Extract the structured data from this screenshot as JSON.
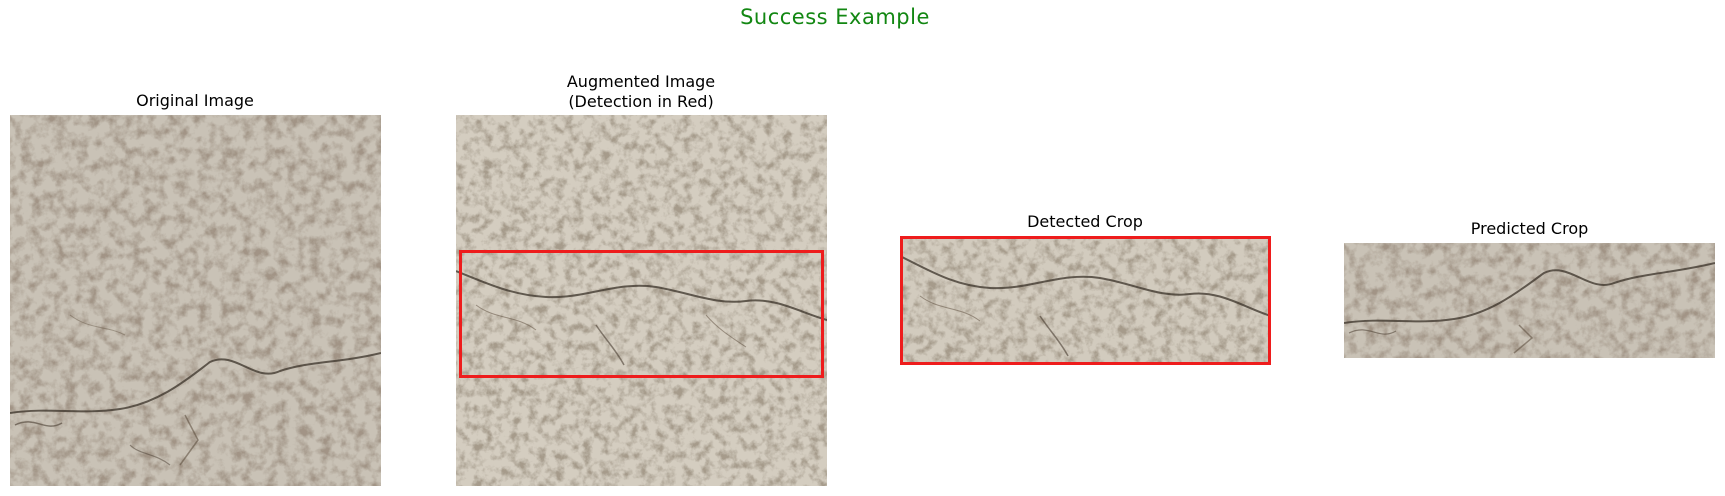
{
  "figure": {
    "title": "Success Example",
    "title_color": "#128712"
  },
  "panels": [
    {
      "title": "Original Image"
    },
    {
      "title": "Augmented Image\n(Detection in Red)"
    },
    {
      "title": "Detected Crop"
    },
    {
      "title": "Predicted Crop"
    }
  ],
  "colors": {
    "detection_box": "#ee1c1c",
    "concrete_base": "#c9c1b4",
    "crack": "#3a3128"
  }
}
